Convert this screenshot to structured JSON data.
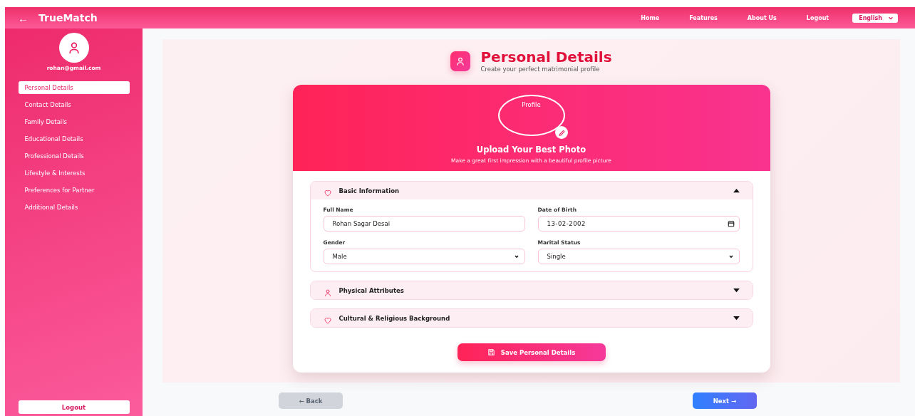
{
  "header": {
    "back_icon": "←",
    "brand": "TrueMatch",
    "nav": [
      "Home",
      "Features",
      "About Us",
      "Logout"
    ],
    "language": "English"
  },
  "sidebar": {
    "email": "rohan@gmail.com",
    "items": [
      {
        "label": "Personal Details",
        "selected": true
      },
      {
        "label": "Contact Details",
        "selected": false
      },
      {
        "label": "Family Details",
        "selected": false
      },
      {
        "label": "Educational Details",
        "selected": false
      },
      {
        "label": "Professional Details",
        "selected": false
      },
      {
        "label": "Lifestyle & Interests",
        "selected": false
      },
      {
        "label": "Preferences for Partner",
        "selected": false
      },
      {
        "label": "Additional Details",
        "selected": false
      }
    ],
    "logout": "Logout"
  },
  "page": {
    "title": "Personal Details",
    "subtitle": "Create your perfect matrimonial profile"
  },
  "photo": {
    "placeholder": "Profile",
    "title": "Upload Your Best Photo",
    "subtitle": "Make a great first impression with a beautiful profile picture"
  },
  "sections": [
    {
      "title": "Basic Information",
      "kind": "heart",
      "expanded": true,
      "fields": [
        {
          "label": "Full Name",
          "kind": "text",
          "value": "Rohan Sagar Desai"
        },
        {
          "label": "Date of Birth",
          "kind": "date",
          "value": "13-02-2002"
        },
        {
          "label": "Gender",
          "kind": "select",
          "value": "Male"
        },
        {
          "label": "Marital Status",
          "kind": "select",
          "value": "Single"
        }
      ]
    },
    {
      "title": "Physical Attributes",
      "kind": "person",
      "expanded": false
    },
    {
      "title": "Cultural & Religious Background",
      "kind": "heart",
      "expanded": false
    }
  ],
  "save_button": "Save Personal Details",
  "footer": {
    "back": "← Back",
    "next": "Next →"
  }
}
